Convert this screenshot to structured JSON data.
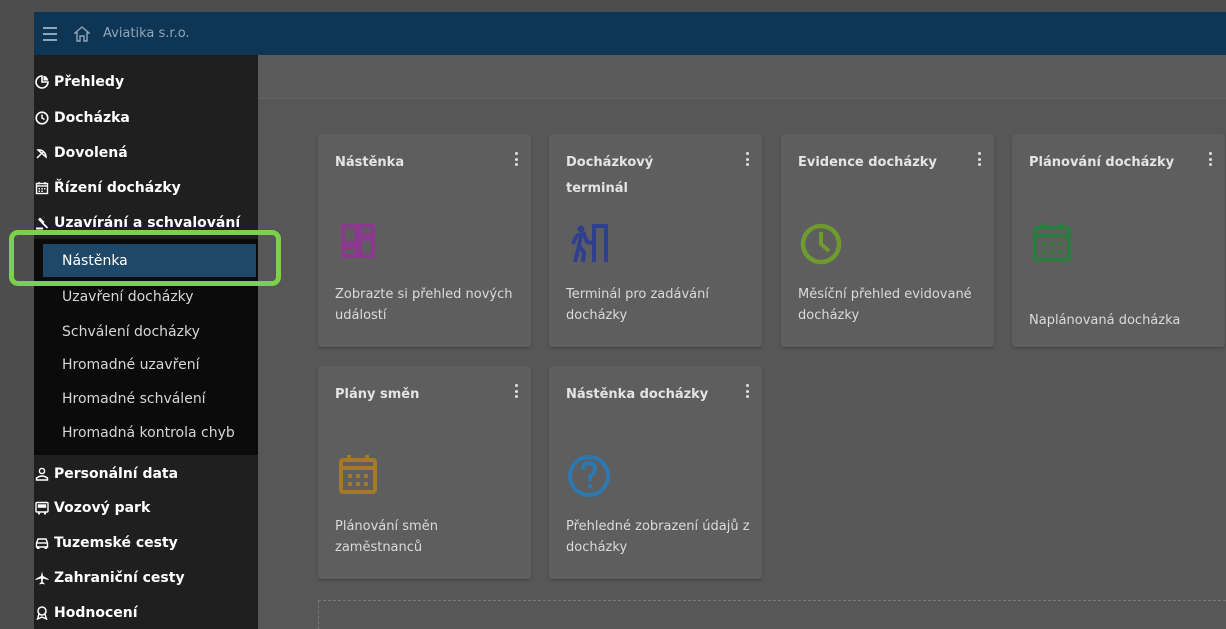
{
  "topbar": {
    "title": "Aviatika s.r.o.",
    "menu_icon": "hamburger-icon",
    "home_icon": "home-icon"
  },
  "sidebar": {
    "items": [
      {
        "label": "Přehledy",
        "icon": "pie-chart-icon"
      },
      {
        "label": "Docházka",
        "icon": "clock-icon"
      },
      {
        "label": "Dovolená",
        "icon": "beach-icon"
      },
      {
        "label": "Řízení docházky",
        "icon": "calendar-icon"
      },
      {
        "label": "Uzavírání a schvalování",
        "icon": "gavel-icon"
      }
    ],
    "sub_items": [
      {
        "label": "Nástěnka",
        "active": true
      },
      {
        "label": "Uzavření docházky"
      },
      {
        "label": "Schválení docházky"
      },
      {
        "label": "Hromadné uzavření"
      },
      {
        "label": "Hromadné schválení"
      },
      {
        "label": "Hromadná kontrola chyb"
      }
    ],
    "items_after": [
      {
        "label": "Personální data",
        "icon": "person-icon"
      },
      {
        "label": "Vozový park",
        "icon": "bus-icon"
      },
      {
        "label": "Tuzemské cesty",
        "icon": "car-icon"
      },
      {
        "label": "Zahraniční cesty",
        "icon": "airplane-icon"
      },
      {
        "label": "Hodnocení",
        "icon": "award-icon"
      }
    ]
  },
  "cards": [
    {
      "title": "Nástěnka",
      "description": "Zobrazte si přehled nových událostí",
      "icon": "dashboard-icon",
      "color": "#8a3a8c"
    },
    {
      "title": "Docházkový terminál",
      "description": "Terminál pro zadávání docházky",
      "icon": "terminal-walk-icon",
      "color": "#2f3f8f"
    },
    {
      "title": "Evidence docházky",
      "description": "Měsíční přehled evidované docházky",
      "icon": "clock-icon",
      "color": "#6f9a2f"
    },
    {
      "title": "Plánování docházky",
      "description": "Naplánovaná docházka",
      "icon": "calendar-icon",
      "color": "#2c7a3e"
    },
    {
      "title": "Plány směn",
      "description": "Plánování směn zaměstnanců",
      "icon": "calendar-icon",
      "color": "#a6782a"
    },
    {
      "title": "Nástěnka docházky",
      "description": "Přehledné zobrazení údajů z docházky",
      "icon": "help-circle-icon",
      "color": "#2c78b0"
    }
  ],
  "colors": {
    "topbar_bg": "#0f3554",
    "active_item_bg": "#1e4768",
    "highlight_border": "#7bd149"
  }
}
